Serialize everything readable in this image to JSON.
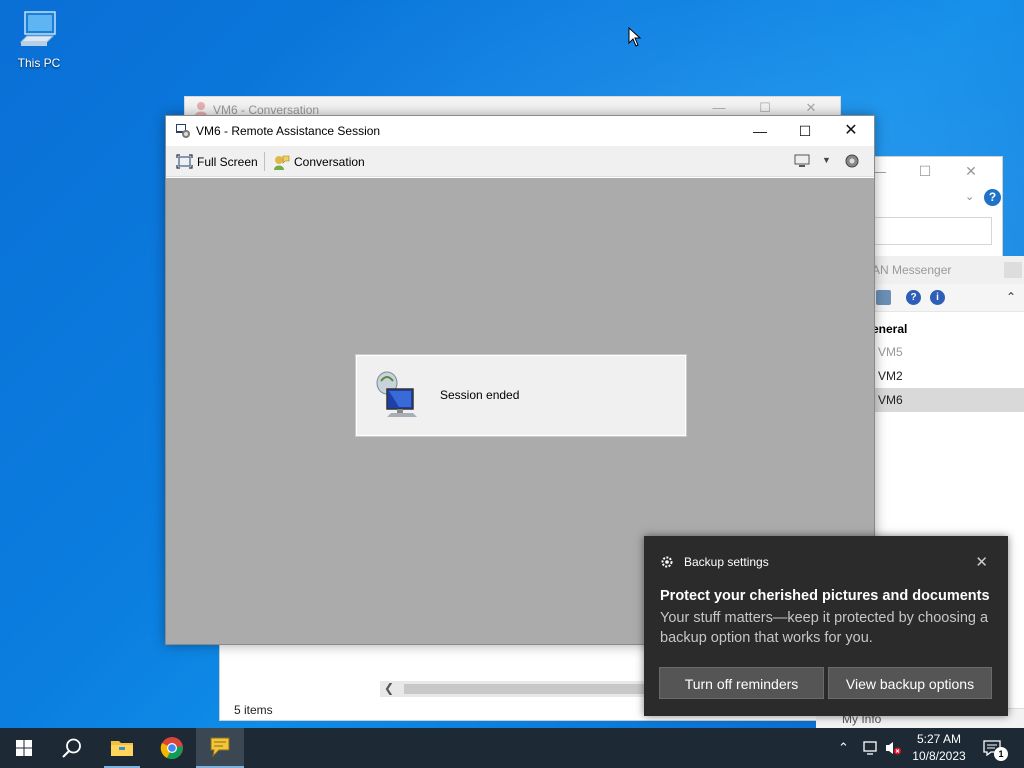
{
  "desktop": {
    "icons": [
      {
        "label": "This PC",
        "icon": "this-pc-icon"
      }
    ]
  },
  "explorer_window": {
    "status_text": "5 items"
  },
  "messenger_window": {
    "title": "AN Messenger",
    "group_label": "eneral",
    "contacts": [
      {
        "name": "VM5",
        "state": "dim"
      },
      {
        "name": "VM2",
        "state": "normal"
      },
      {
        "name": "VM6",
        "state": "selected"
      }
    ],
    "my_info_label": "My Info"
  },
  "conversation_window": {
    "title": "VM6 - Conversation"
  },
  "remote_assistance_window": {
    "title": "VM6 - Remote Assistance Session",
    "toolbar": {
      "full_screen_label": "Full Screen",
      "conversation_label": "Conversation"
    },
    "session_message": "Session ended"
  },
  "toast": {
    "app_name": "Backup settings",
    "headline": "Protect your cherished pictures and documents",
    "body": "Your stuff matters—keep it protected by choosing a backup option that works for you.",
    "button_primary": "Turn off reminders",
    "button_secondary": "View backup options"
  },
  "taskbar": {
    "pinned": [
      "start-icon",
      "search-icon",
      "file-explorer-icon",
      "chrome-icon",
      "messenger-icon"
    ],
    "clock_time": "5:27 AM",
    "clock_date": "10/8/2023",
    "notification_count": "1"
  },
  "colors": {
    "desktop_blue": "#0b7ee0",
    "taskbar": "#1d2a36",
    "toast_bg": "#2b2b2b",
    "session_area": "#ababab"
  }
}
